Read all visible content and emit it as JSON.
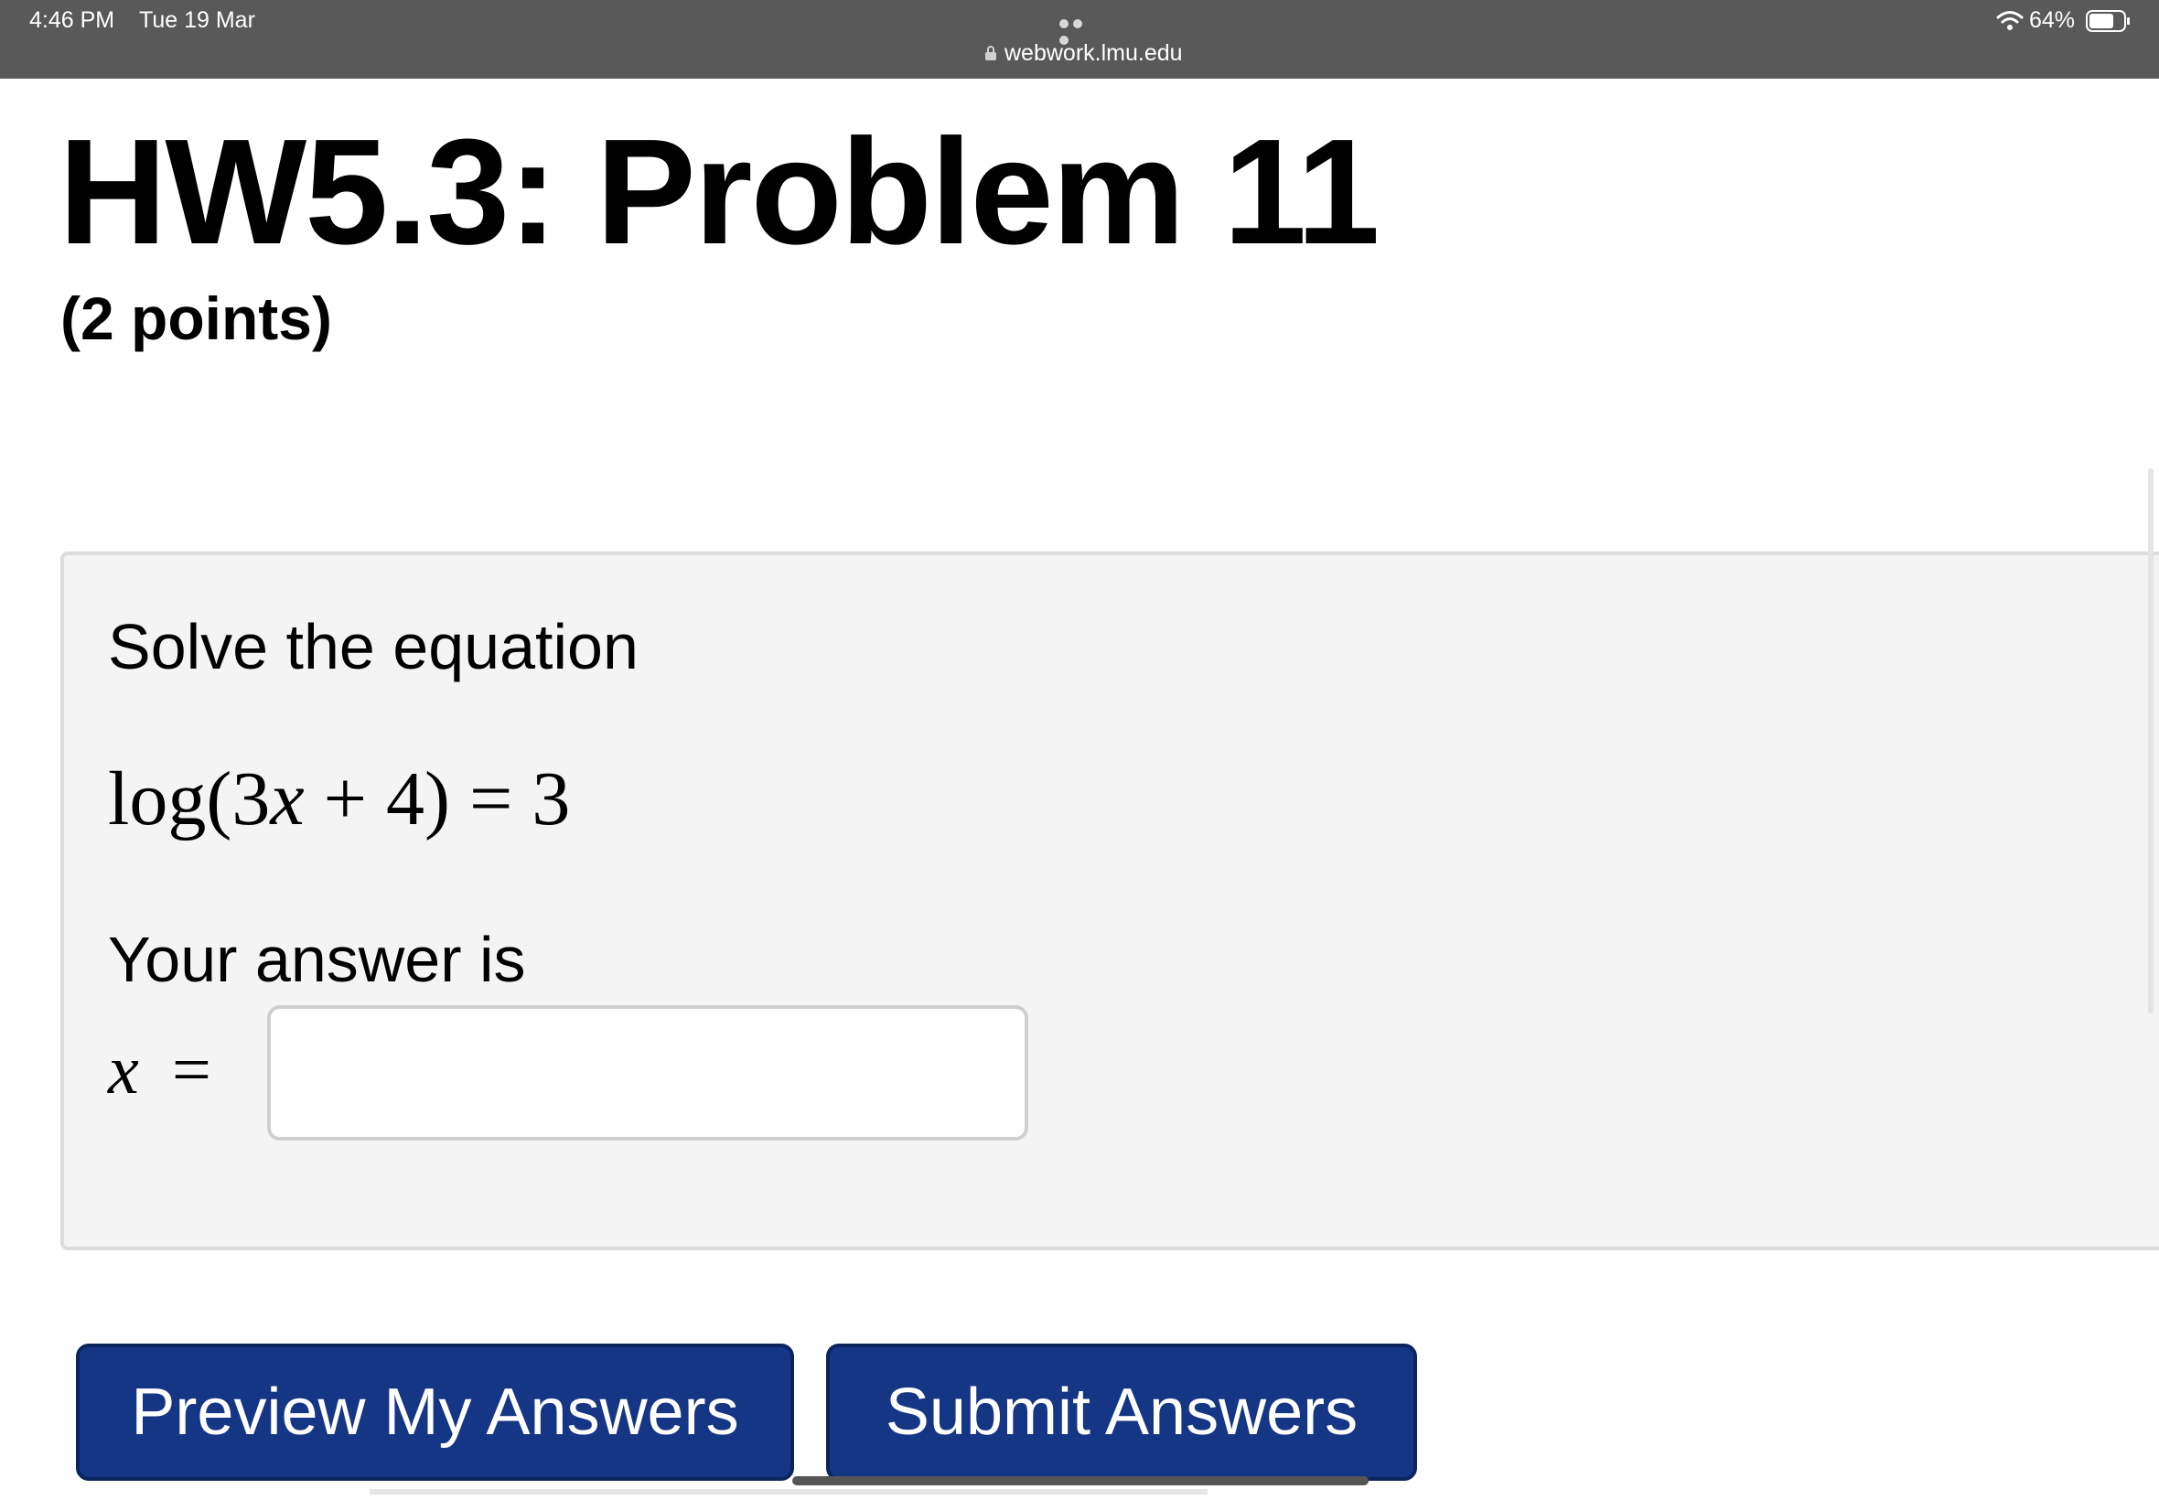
{
  "status_bar": {
    "time": "4:46 PM",
    "date": "Tue 19 Mar",
    "url": "webwork.lmu.edu",
    "battery": "64%"
  },
  "page": {
    "title": "HW5.3: Problem 11",
    "points": "(2 points)"
  },
  "problem": {
    "prompt": "Solve the equation",
    "equation": {
      "func": "log",
      "open": "(",
      "coef": "3",
      "var": "x",
      "plus": " + ",
      "const": "4",
      "close": ")",
      "equals": " = ",
      "rhs": "3"
    },
    "answer_label": "Your answer is",
    "answer_var": "x",
    "answer_equals": "=",
    "answer_value": ""
  },
  "buttons": {
    "preview": "Preview My Answers",
    "submit": "Submit Answers"
  },
  "colors": {
    "topbar": "#595959",
    "button": "#153585",
    "problem_bg": "#f4f4f4"
  }
}
